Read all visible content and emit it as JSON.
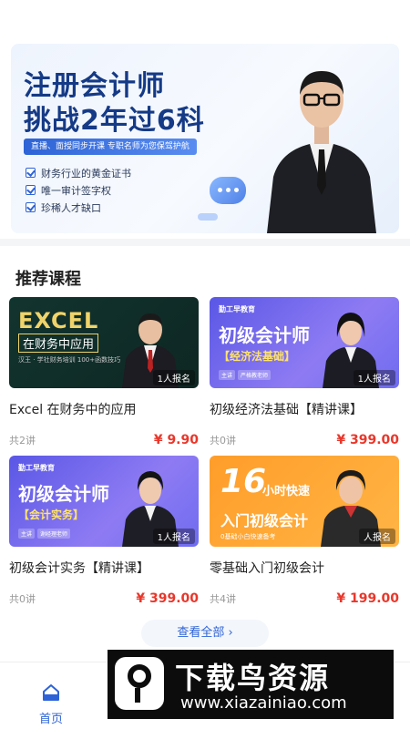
{
  "banner": {
    "title_line1": "注册会计师",
    "title_line2": "挑战2年过6科",
    "subtitle": "直播、面授同步开课  专职名师为您保驾护航",
    "features": [
      "财务行业的黄金证书",
      "唯一审计签字权",
      "珍稀人才缺口"
    ]
  },
  "section": {
    "title": "推荐课程"
  },
  "courses": [
    {
      "title": "Excel 在财务中的应用",
      "lessons": "共2讲",
      "price": "¥ 9.90",
      "enrolled": "1人报名",
      "thumb": {
        "big": "EXCEL",
        "sub": "在财务中应用",
        "small": "汉王 · 学社财务培训\n100+函数技巧"
      }
    },
    {
      "title": "初级经济法基础【精讲课】",
      "lessons": "共0讲",
      "price": "¥ 399.00",
      "enrolled": "1人报名",
      "thumb": {
        "logo": "勤工早教育",
        "big": "初级会计师",
        "sub": "【经济法基础】",
        "tags": [
          "主讲",
          "严格教老师"
        ]
      }
    },
    {
      "title": "初级会计实务【精讲课】",
      "lessons": "共0讲",
      "price": "¥ 399.00",
      "enrolled": "1人报名",
      "thumb": {
        "logo": "勤工早教育",
        "big": "初级会计师",
        "sub": "【会计实务】",
        "tags": [
          "主讲",
          "谢经理老师"
        ]
      }
    },
    {
      "title": "零基础入门初级会计",
      "lessons": "共4讲",
      "price": "¥ 199.00",
      "enrolled": "人报名",
      "thumb": {
        "num": "16",
        "hr": "小时快速",
        "big": "入门初级会计",
        "small": "0基础小白快速备考"
      }
    }
  ],
  "see_all": "查看全部 ›",
  "tabbar": {
    "home_label": "首页"
  },
  "watermark": {
    "title": "下载鸟资源",
    "url": "www.xiazainiao.com"
  },
  "colors": {
    "accent": "#2d63d6",
    "price": "#e9372b"
  }
}
